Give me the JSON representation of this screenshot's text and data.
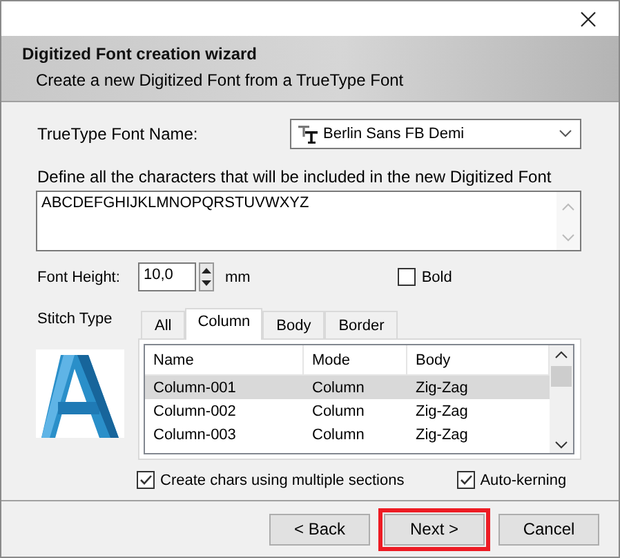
{
  "header": {
    "title": "Digitized Font creation wizard",
    "subtitle": "Create a new Digitized Font from a TrueType Font"
  },
  "font_name": {
    "label": "TrueType Font Name:",
    "value": "Berlin Sans FB Demi"
  },
  "characters": {
    "label": "Define all the characters that will be included in the new Digitized Font",
    "value": "ABCDEFGHIJKLMNOPQRSTUVWXYZ"
  },
  "font_height": {
    "label": "Font Height:",
    "value": "10,0",
    "unit": "mm"
  },
  "bold": {
    "label": "Bold",
    "checked": false
  },
  "stitch_type": {
    "label": "Stitch Type",
    "tabs": [
      {
        "label": "All",
        "selected": false
      },
      {
        "label": "Column",
        "selected": true
      },
      {
        "label": "Body",
        "selected": false
      },
      {
        "label": "Border",
        "selected": false
      }
    ],
    "table": {
      "columns": [
        "Name",
        "Mode",
        "Body"
      ],
      "rows": [
        {
          "cells": [
            "Column-001",
            "Column",
            "Zig-Zag"
          ],
          "selected": true
        },
        {
          "cells": [
            "Column-002",
            "Column",
            "Zig-Zag"
          ],
          "selected": false
        },
        {
          "cells": [
            "Column-003",
            "Column",
            "Zig-Zag"
          ],
          "selected": false
        }
      ]
    }
  },
  "options": [
    {
      "label": "Create chars using multiple sections",
      "checked": true
    },
    {
      "label": "Auto-kerning",
      "checked": true
    }
  ],
  "buttons": [
    {
      "label": "< Back",
      "highlighted": false
    },
    {
      "label": "Next >",
      "highlighted": true
    },
    {
      "label": "Cancel",
      "highlighted": false
    }
  ]
}
